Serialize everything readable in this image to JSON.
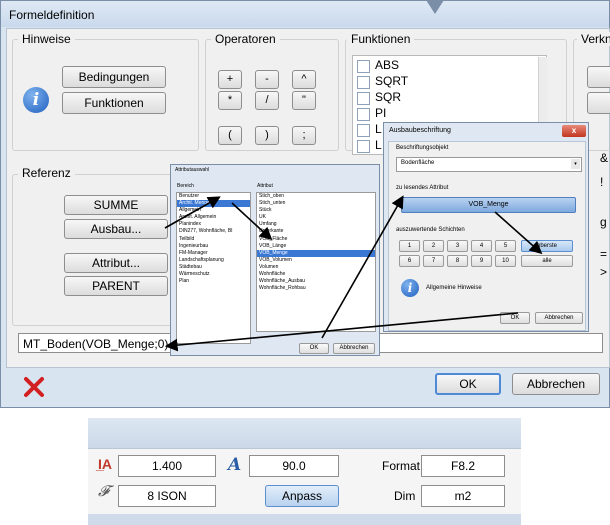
{
  "main_window": {
    "title": "Formeldefinition",
    "hinweise": {
      "label": "Hinweise",
      "bedingungen": "Bedingungen",
      "funktionen": "Funktionen"
    },
    "operatoren": {
      "label": "Operatoren",
      "ops": [
        "+",
        "-",
        "^",
        "*",
        "/",
        "\"",
        "(",
        ")",
        ";"
      ]
    },
    "funktionen": {
      "label": "Funktionen",
      "items": [
        "ABS",
        "SQRT",
        "SQR",
        "PI",
        "L",
        "L"
      ]
    },
    "verkn_label": "Verkn",
    "referenz": {
      "label": "Referenz",
      "summe": "SUMME",
      "ausbau": "Ausbau...",
      "attribut": "Attribut...",
      "parent": "PARENT"
    },
    "formula": "MT_Boden(VOB_Menge;0)",
    "ok": "OK",
    "abbrechen": "Abbrechen",
    "side_glyphs": [
      "&",
      "!",
      "g",
      "=",
      ">"
    ]
  },
  "attribut_dialog": {
    "title": "Attributauswahl",
    "bereich_label": "Bereich",
    "attribut_label": "Attribut",
    "bereich_items": [
      "Benutzer",
      "Archit. Mengen",
      "Allgemein",
      "Archit. Allgemein",
      "Planindex",
      "DIN277, Wohnfläche, BI",
      "Teilbild",
      "Ingenieurbau",
      "FM-Manager",
      "Landschaftsplanung",
      "Städtebau",
      "Wärmeschutz",
      "Plan"
    ],
    "attribut_items": [
      "Stich_oben",
      "Stich_unten",
      "Stück",
      "UK",
      "Umfang",
      "Unterkante",
      "VOB_Fläche",
      "VOB_Länge",
      "VOB_Menge",
      "VOB_Volumen",
      "Volumen",
      "Wohnfläche",
      "Wohnfläche_Ausbau",
      "Wohnfläche_Rohbau"
    ],
    "bereich_selected": 1,
    "attribut_selected": 8,
    "ok": "OK",
    "abbrechen": "Abbrechen"
  },
  "ausbau_dialog": {
    "title": "Ausbaubeschriftung",
    "close": "x",
    "beschriftungsobjekt_label": "Beschriftungsobjekt",
    "beschriftungsobjekt_value": "Bodenfläche",
    "zu_lesendes_label": "zu lesendes Attribut",
    "attribut_value": "VOB_Menge",
    "schichten_label": "auszuwertende Schichten",
    "schichten": [
      "1",
      "2",
      "3",
      "4",
      "5",
      "6",
      "7",
      "8",
      "9",
      "10"
    ],
    "oberste": "oberste",
    "alle": "alle",
    "hinweise": "Allgemeine Hinweise",
    "ok": "OK",
    "abbrechen": "Abbrechen"
  },
  "toolbar": {
    "height_value": "1.400",
    "angle_value": "90.0",
    "format_label": "Format",
    "format_value": "F8.2",
    "font_value": "8 ISON",
    "anpass": "Anpass",
    "dim_label": "Dim",
    "dim_value": "m2"
  },
  "colors": {
    "accent": "#3a78d4",
    "close_red": "#c1351f",
    "delete_red": "#d21f1f"
  }
}
